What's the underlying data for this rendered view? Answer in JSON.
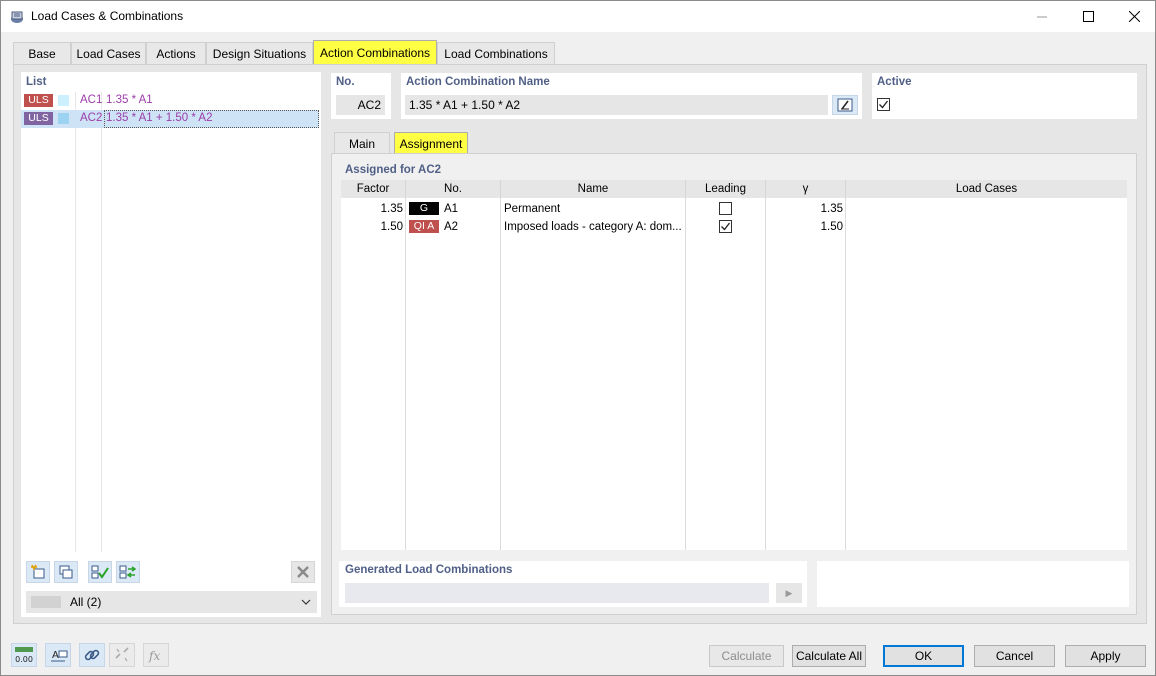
{
  "window": {
    "title": "Load Cases & Combinations"
  },
  "tabs": [
    {
      "label": "Base"
    },
    {
      "label": "Load Cases"
    },
    {
      "label": "Actions"
    },
    {
      "label": "Design Situations"
    },
    {
      "label": "Action Combinations",
      "active": true
    },
    {
      "label": "Load Combinations"
    }
  ],
  "list": {
    "label": "List",
    "items": [
      {
        "badge": "ULS",
        "badge_color": "#c0504d",
        "swatch_color": "#cdf0ff",
        "no": "AC1",
        "name": "1.35 * A1"
      },
      {
        "badge": "ULS",
        "badge_color": "#8064a2",
        "swatch_color": "#9cd3f0",
        "no": "AC2",
        "name": "1.35 * A1 + 1.50 * A2",
        "selected": true
      }
    ],
    "filter": "All (2)"
  },
  "header": {
    "no_label": "No.",
    "no_value": "AC2",
    "name_label": "Action Combination Name",
    "name_value": "1.35 * A1 + 1.50 * A2",
    "active_label": "Active",
    "active_checked": true
  },
  "subtabs": [
    {
      "label": "Main"
    },
    {
      "label": "Assignment",
      "active": true
    }
  ],
  "assignment": {
    "title": "Assigned for AC2",
    "columns": [
      "Factor",
      "No.",
      "Name",
      "Leading",
      "γ",
      "Load Cases"
    ],
    "rows": [
      {
        "factor": "1.35",
        "badge": "G",
        "badge_color": "#000000",
        "no": "A1",
        "name": "Permanent",
        "leading": false,
        "gamma": "1.35",
        "load_cases": ""
      },
      {
        "factor": "1.50",
        "badge": "QI A",
        "badge_color": "#c0504d",
        "no": "A2",
        "name": "Imposed loads - category A: dom...",
        "leading": true,
        "gamma": "1.50",
        "load_cases": ""
      }
    ]
  },
  "generated": {
    "label": "Generated Load Combinations",
    "value": ""
  },
  "buttons": {
    "calculate": "Calculate",
    "calculate_all": "Calculate All",
    "ok": "OK",
    "cancel": "Cancel",
    "apply": "Apply"
  },
  "footer_icons": [
    "units-icon",
    "display-icon",
    "link-icon",
    "unlink-icon",
    "formula-icon"
  ],
  "footer_units_text": "0.00",
  "footer_formula_text": "fx"
}
